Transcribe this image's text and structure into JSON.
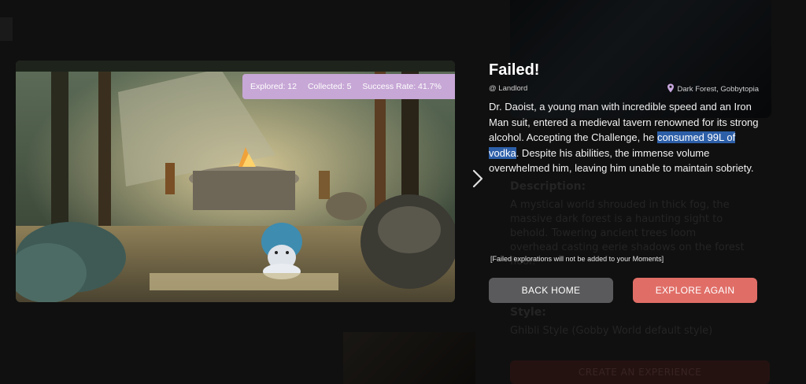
{
  "background": {
    "description_title": "Description:",
    "description_text": "A mystical world shrouded in thick fog, the massive dark forest is a haunting sight to behold. Towering ancient trees loom overhead casting eerie shadows on the forest floor.",
    "style_title": "Style:",
    "style_text": "Ghibli Style (Gobby World default style)",
    "create_label": "CREATE AN EXPERIENCE"
  },
  "stats": {
    "explored": "Explored: 12",
    "collected": "Collected: 5",
    "success_rate": "Success Rate: 41.7%"
  },
  "result": {
    "title": "Failed!",
    "author": "@ Landlord",
    "location": "Dark Forest, Gobbytopia",
    "story_before": "Dr. Daoist, a young man with incredible speed and an Iron Man suit, entered a medieval tavern renowned for its strong alcohol. Accepting the Challenge, he ",
    "story_highlight": "consumed 99L of vodka",
    "story_after": ". Despite his abilities, the immense volume overwhelmed him, leaving him unable to maintain sobriety.",
    "notice": "[Failed explorations will not be added to your Moments]"
  },
  "buttons": {
    "back_home": "BACK HOME",
    "explore_again": "EXPLORE AGAIN"
  },
  "colors": {
    "stats_pill": "#c7a7d6",
    "back_home_bg": "#5a5a5c",
    "explore_again_bg": "#e06e67",
    "highlight": "#2d5fa8"
  },
  "icons": {
    "location": "location-pin-icon",
    "next": "chevron-right-icon"
  }
}
